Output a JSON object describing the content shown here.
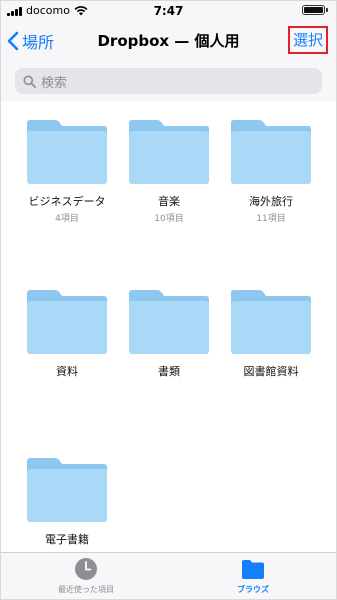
{
  "status_bar": {
    "carrier": "docomo",
    "time": "7:47"
  },
  "nav": {
    "back_label": "場所",
    "title": "Dropbox — 個人用",
    "select_label": "選択"
  },
  "search": {
    "placeholder": "検索"
  },
  "folders": [
    {
      "name": "ビジネスデータ",
      "count": "4項目"
    },
    {
      "name": "音楽",
      "count": "10項目"
    },
    {
      "name": "海外旅行",
      "count": "11項目"
    },
    {
      "name": "資料",
      "count": ""
    },
    {
      "name": "書類",
      "count": ""
    },
    {
      "name": "図書館資料",
      "count": ""
    },
    {
      "name": "電子書籍",
      "count": ""
    }
  ],
  "tabs": [
    {
      "label": "最近使った項目",
      "icon": "clock-icon",
      "active": false
    },
    {
      "label": "ブラウズ",
      "icon": "folder-icon",
      "active": true
    }
  ],
  "colors": {
    "accent": "#157efb",
    "highlight_border": "#e0202a",
    "folder_light": "#aad8f7",
    "folder_dark": "#8ec8f1"
  }
}
